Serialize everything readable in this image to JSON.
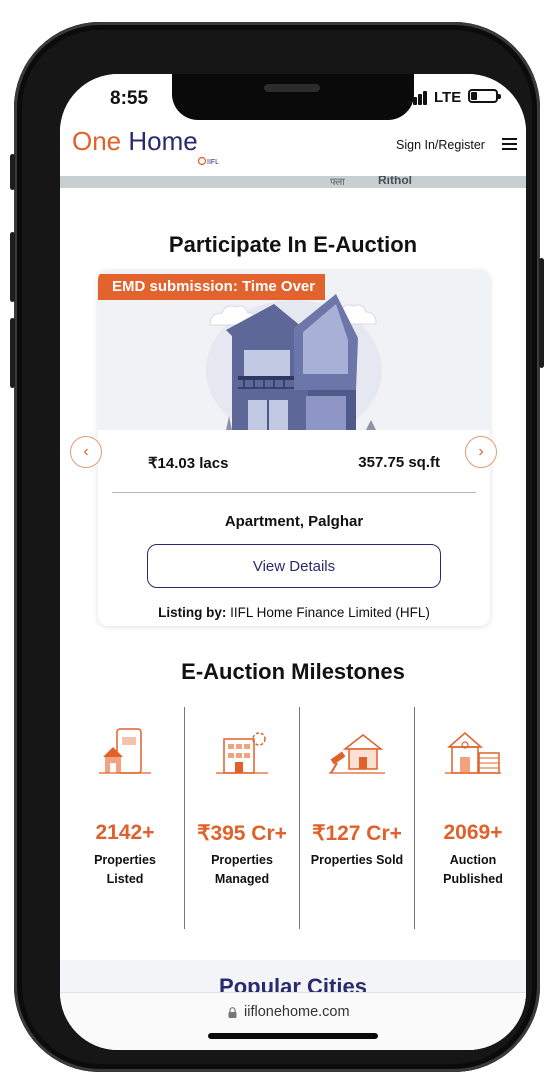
{
  "status_bar": {
    "time": "8:55",
    "network": "LTE"
  },
  "header": {
    "logo_one": "One",
    "logo_home": "Home",
    "logo_sub": "IIFL",
    "signin": "Sign In/Register"
  },
  "map": {
    "label_1": "फ्ला",
    "label_2": "Rithol"
  },
  "auction": {
    "title": "Participate In E-Auction",
    "badge": "EMD submission: Time Over",
    "price": "₹14.03 lacs",
    "area": "357.75 sq.ft",
    "property_type": "Apartment, Palghar",
    "view_details": "View Details",
    "listing_label": "Listing by:",
    "listing_value": " IIFL Home Finance Limited (HFL)",
    "prev_arrow": "‹",
    "next_arrow": "›"
  },
  "milestones": {
    "title": "E-Auction Milestones",
    "items": [
      {
        "value": "2142+",
        "label": "Properties Listed",
        "icon": "properties-listed-icon"
      },
      {
        "value": "₹395 Cr+",
        "label": "Properties Managed",
        "icon": "properties-managed-icon"
      },
      {
        "value": "₹127 Cr+",
        "label": "Properties Sold",
        "icon": "auction-hammer-house-icon"
      },
      {
        "value": "2069+",
        "label": "Auction Published",
        "icon": "house-garage-icon"
      }
    ]
  },
  "popular": {
    "title": "Popular Cities"
  },
  "browser": {
    "url": "iiflonehome.com"
  },
  "colors": {
    "brand_orange": "#e0612a",
    "brand_navy": "#2a2a6e"
  }
}
